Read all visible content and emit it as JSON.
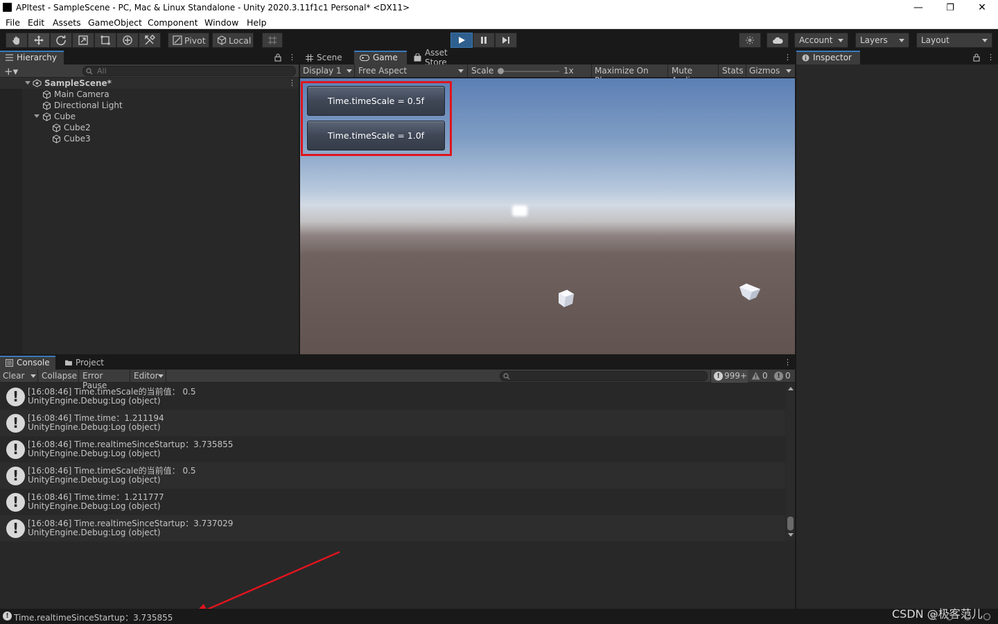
{
  "window": {
    "title": "APItest - SampleScene - PC, Mac & Linux Standalone - Unity 2020.3.11f1c1 Personal* <DX11>",
    "minimize": "—",
    "maximize": "❐",
    "close": "✕"
  },
  "menu": [
    "File",
    "Edit",
    "Assets",
    "GameObject",
    "Component",
    "Window",
    "Help"
  ],
  "toolbar": {
    "pivot": "Pivot",
    "local": "Local",
    "account": "Account",
    "layers": "Layers",
    "layout": "Layout"
  },
  "hierarchy": {
    "tab": "Hierarchy",
    "search_placeholder": "All",
    "items": [
      {
        "label": "SampleScene*",
        "depth": 0
      },
      {
        "label": "Main Camera",
        "depth": 1
      },
      {
        "label": "Directional Light",
        "depth": 1
      },
      {
        "label": "Cube",
        "depth": 1
      },
      {
        "label": "Cube2",
        "depth": 2
      },
      {
        "label": "Cube3",
        "depth": 2
      }
    ]
  },
  "game": {
    "tabs": [
      "Scene",
      "Game",
      "Asset Store"
    ],
    "display": "Display 1",
    "aspect": "Free Aspect",
    "scale_label": "Scale",
    "scale_value": "1x",
    "maximize": "Maximize On Play",
    "mute": "Mute Audio",
    "stats": "Stats",
    "gizmos": "Gizmos",
    "buttons": [
      "Time.timeScale = 0.5f",
      "Time.timeScale = 1.0f"
    ]
  },
  "inspector": {
    "tab": "Inspector"
  },
  "console": {
    "tabs": [
      "Console",
      "Project"
    ],
    "clear": "Clear",
    "collapse": "Collapse",
    "error_pause": "Error Pause",
    "editor": "Editor",
    "log_count": "999+",
    "warn_count": "0",
    "error_count": "0",
    "entries": [
      {
        "line1": "[16:08:46] Time.timeScale的当前值： 0.5",
        "line2": "UnityEngine.Debug:Log (object)"
      },
      {
        "line1": "[16:08:46] Time.time：1.211194",
        "line2": "UnityEngine.Debug:Log (object)"
      },
      {
        "line1": "[16:08:46] Time.realtimeSinceStartup：3.735855",
        "line2": "UnityEngine.Debug:Log (object)"
      },
      {
        "line1": "[16:08:46] Time.timeScale的当前值： 0.5",
        "line2": "UnityEngine.Debug:Log (object)"
      },
      {
        "line1": "[16:08:46] Time.time：1.211777",
        "line2": "UnityEngine.Debug:Log (object)"
      },
      {
        "line1": "[16:08:46] Time.realtimeSinceStartup：3.737029",
        "line2": "UnityEngine.Debug:Log (object)"
      }
    ]
  },
  "statusbar": {
    "message": "Time.realtimeSinceStartup：3.735855",
    "watermark": "CSDN @极客范儿"
  },
  "annotation_color": "#e0141e"
}
